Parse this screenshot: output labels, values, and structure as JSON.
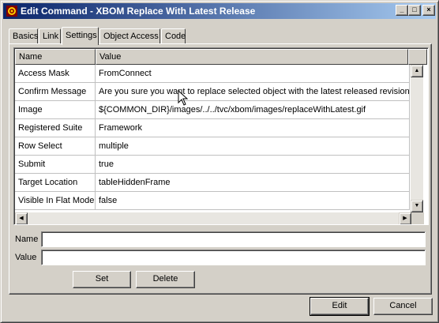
{
  "window": {
    "title": "Edit Command - XBOM Replace With Latest Release",
    "controls": {
      "minimize": "_",
      "maximize": "□",
      "close": "×"
    }
  },
  "tabs": [
    "Basics",
    "Link",
    "Settings",
    "Object Access",
    "Code"
  ],
  "active_tab": "Settings",
  "grid": {
    "columns": [
      "Name",
      "Value"
    ],
    "rows": [
      {
        "name": "Access Mask",
        "value": "FromConnect"
      },
      {
        "name": "Confirm Message",
        "value": "Are you sure you want to replace selected object with the latest released revision?"
      },
      {
        "name": "Image",
        "value": "${COMMON_DIR}/images/../../tvc/xbom/images/replaceWithLatest.gif"
      },
      {
        "name": "Registered Suite",
        "value": "Framework"
      },
      {
        "name": "Row Select",
        "value": "multiple"
      },
      {
        "name": "Submit",
        "value": "true"
      },
      {
        "name": "Target Location",
        "value": "tableHiddenFrame"
      },
      {
        "name": "Visible In Flat Mode",
        "value": "false"
      }
    ]
  },
  "form": {
    "name_label": "Name",
    "name_value": "",
    "value_label": "Value",
    "value_value": ""
  },
  "buttons": {
    "set": "Set",
    "delete": "Delete",
    "edit": "Edit",
    "cancel": "Cancel"
  },
  "icons": {
    "title_icon": "app-gear-icon",
    "scroll_up": "▲",
    "scroll_down": "▼",
    "scroll_left": "◀",
    "scroll_right": "▶"
  },
  "colors": {
    "title_gradient_start": "#0a246a",
    "title_gradient_end": "#a6caf0",
    "face": "#d4d0c8"
  }
}
